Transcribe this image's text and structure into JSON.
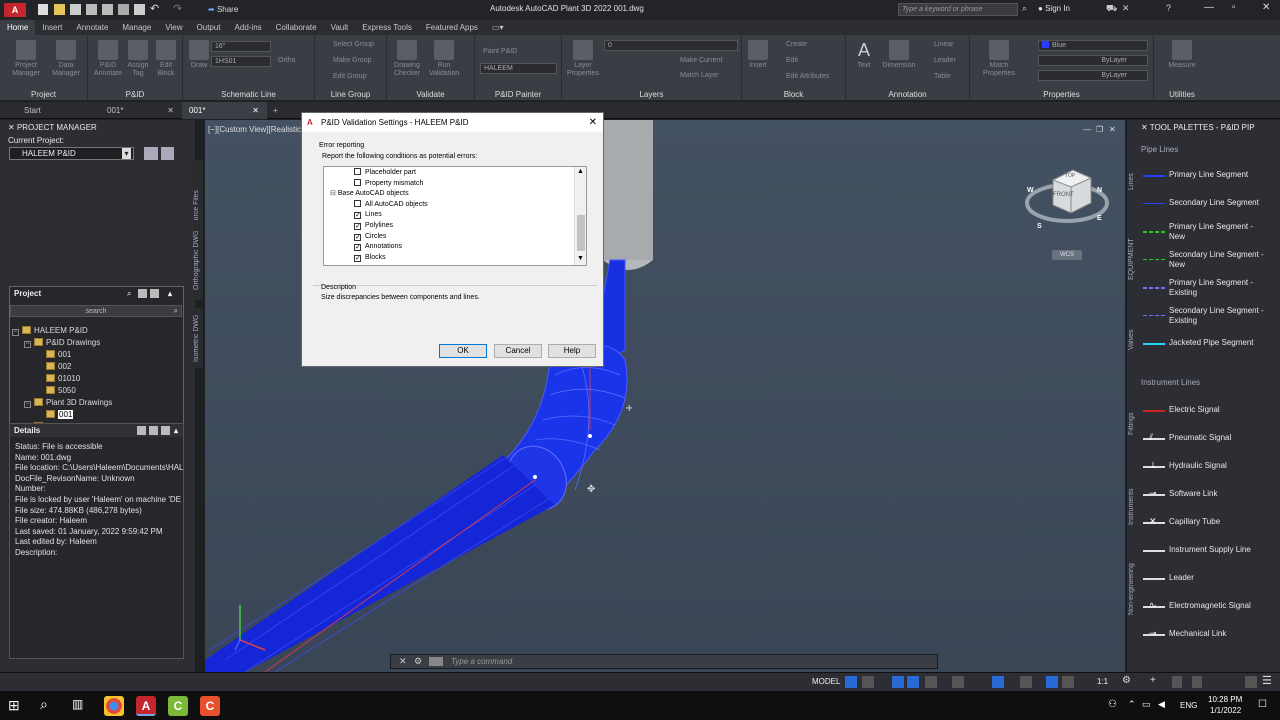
{
  "app": {
    "title": "Autodesk AutoCAD Plant 3D 2022   001.dwg",
    "share_label": "Share",
    "search_placeholder": "Type a keyword or phrase",
    "sign_in_label": "Sign In"
  },
  "ribbon_tabs": [
    "Home",
    "Insert",
    "Annotate",
    "Manage",
    "View",
    "Output",
    "Add-ins",
    "Collaborate",
    "Vault",
    "Express Tools",
    "Featured Apps"
  ],
  "ribbon_panels": {
    "project": {
      "title": "Project",
      "btn1": "Project Manager",
      "btn2": "Data Manager"
    },
    "pid": {
      "title": "P&ID",
      "btn1": "P&ID Annotate",
      "btn2": "Assign Tag",
      "btn3": "Edit Block"
    },
    "schematic": {
      "title": "Schematic Line",
      "size": "16\"",
      "spec": "1HS01",
      "draw": "Draw",
      "ortho": "Ortho"
    },
    "linegroup": {
      "title": "Line Group",
      "select": "Select Group",
      "edit": "Edit",
      "make": "Make Group",
      "edit_group": "Edit Group"
    },
    "validate": {
      "title": "Validate",
      "btn1": "Drawing Checker",
      "btn2": "Run Validation"
    },
    "painter": {
      "title": "P&ID Painter",
      "paint": "Paint P&ID",
      "value": "HALEEM"
    },
    "layers": {
      "title": "Layers",
      "layer_props": "Layer Properties",
      "layer_value": "0",
      "make_current": "Make Current",
      "match_layer": "Match Layer"
    },
    "block": {
      "title": "Block",
      "insert": "Insert",
      "create": "Create",
      "edit": "Edit",
      "edit_attr": "Edit Attributes"
    },
    "annotation": {
      "title": "Annotation",
      "text": "Text",
      "dimension": "Dimension",
      "linear": "Linear",
      "leader": "Leader",
      "table": "Table"
    },
    "properties": {
      "title": "Properties",
      "match": "Match Properties",
      "color": "Blue",
      "bylayer1": "ByLayer",
      "bylayer2": "ByLayer"
    },
    "utilities": {
      "title": "Utilities",
      "measure": "Measure"
    }
  },
  "doc_tabs": [
    {
      "label": "Start"
    },
    {
      "label": "001*"
    },
    {
      "label": "001*"
    }
  ],
  "viewport_label": "[−][Custom View][Realistic]",
  "project_manager": {
    "title": "PROJECT MANAGER",
    "current_project_label": "Current Project:",
    "current_project": "HALEEM P&ID",
    "project_header": "Project",
    "search_placeholder": "search",
    "tree": [
      {
        "label": "HALEEM P&ID",
        "level": 0,
        "exp": "−"
      },
      {
        "label": "P&ID Drawings",
        "level": 1,
        "exp": "−"
      },
      {
        "label": "001",
        "level": 2,
        "exp": ""
      },
      {
        "label": "002",
        "level": 2,
        "exp": ""
      },
      {
        "label": "01010",
        "level": 2,
        "exp": ""
      },
      {
        "label": "5050",
        "level": 2,
        "exp": ""
      },
      {
        "label": "Plant 3D Drawings",
        "level": 1,
        "exp": "−"
      },
      {
        "label": "001",
        "level": 2,
        "exp": "",
        "selected": true
      },
      {
        "label": "Pipe Specs",
        "level": 1,
        "exp": "+"
      },
      {
        "label": "Related Files",
        "level": 1,
        "exp": "+"
      }
    ],
    "side_tabs": [
      "Source Files",
      "Orthographic DWG",
      "Isometric DWG"
    ]
  },
  "details": {
    "title": "Details",
    "lines": [
      "Status: File is accessible",
      "Name: 001.dwg",
      "File location: C:\\Users\\Haleem\\Documents\\HAL",
      "DocFile_RevisonName:  Unknown",
      "Number:",
      "File is locked by user 'Haleem' on machine 'DE",
      "File size: 474.88KB (486,278 bytes)",
      "File creator: Haleem",
      "Last saved: 01 January, 2022 9:59:42 PM",
      "Last edited by: Haleem",
      "Description:"
    ]
  },
  "dialog": {
    "title": "P&ID Validation Settings - HALEEM P&ID",
    "group_label": "Error reporting",
    "instruction": "Report the following conditions as potential errors:",
    "items": [
      {
        "label": "Placeholder part",
        "checked": false,
        "indent": 2
      },
      {
        "label": "Property mismatch",
        "checked": false,
        "indent": 2
      },
      {
        "label": "Base AutoCAD objects",
        "checked": null,
        "indent": 0,
        "exp": "−"
      },
      {
        "label": "All AutoCAD objects",
        "checked": false,
        "indent": 2
      },
      {
        "label": "Lines",
        "checked": true,
        "indent": 2
      },
      {
        "label": "Polylines",
        "checked": true,
        "indent": 2
      },
      {
        "label": "Circles",
        "checked": true,
        "indent": 2
      },
      {
        "label": "Annotations",
        "checked": true,
        "indent": 2
      },
      {
        "label": "Blocks",
        "checked": true,
        "indent": 2
      }
    ],
    "description_label": "Description",
    "description_text": "Size discrepancies between components and lines.",
    "ok_label": "OK",
    "cancel_label": "Cancel",
    "help_label": "Help"
  },
  "viewcube": {
    "top": "TOP",
    "front": "FRONT",
    "compass": [
      "N",
      "E",
      "S",
      "W"
    ],
    "wcs": "WCS"
  },
  "tool_palette": {
    "title": "TOOL PALETTES - P&ID PIP",
    "pipe_lines_group": "Pipe Lines",
    "pipe_lines": [
      {
        "label": "Primary Line Segment",
        "color": "#2a3cff",
        "style": "solid",
        "width": 2
      },
      {
        "label": "Secondary Line Segment",
        "color": "#2a3cff",
        "style": "solid",
        "width": 1
      },
      {
        "label": "Primary Line Segment - New",
        "color": "#22cc22",
        "style": "dashed",
        "width": 2
      },
      {
        "label": "Secondary Line Segment - New",
        "color": "#22cc22",
        "style": "dashed",
        "width": 1
      },
      {
        "label": "Primary Line Segment - Existing",
        "color": "#7a6cff",
        "style": "dashed",
        "width": 2
      },
      {
        "label": "Secondary Line Segment - Existing",
        "color": "#7a6cff",
        "style": "dashed",
        "width": 1
      },
      {
        "label": "Jacketed Pipe Segment",
        "color": "#22d8ff",
        "style": "solid",
        "width": 2
      }
    ],
    "instrument_lines_group": "Instrument Lines",
    "instrument_lines": [
      {
        "label": "Electric Signal",
        "color": "#cc2222"
      },
      {
        "label": "Pneumatic Signal",
        "color": "#dddddd"
      },
      {
        "label": "Hydraulic Signal",
        "color": "#dddddd"
      },
      {
        "label": "Software Link",
        "color": "#dddddd"
      },
      {
        "label": "Capillary Tube",
        "color": "#dddddd"
      },
      {
        "label": "Instrument Supply Line",
        "color": "#dddddd"
      },
      {
        "label": "Leader",
        "color": "#dddddd"
      },
      {
        "label": "Electromagnetic Signal",
        "color": "#dddddd"
      },
      {
        "label": "Mechanical Link",
        "color": "#dddddd"
      }
    ],
    "side_tabs": [
      "Lines",
      "EQUIPMENT",
      "Valves",
      "Fittings",
      "Instruments",
      "Non-engineering"
    ]
  },
  "command_line": {
    "placeholder": "Type a command"
  },
  "status_bar": {
    "model": "MODEL",
    "scale": "1:1"
  },
  "taskbar": {
    "language": "ENG",
    "time": "10:28 PM",
    "date": "1/1/2022"
  },
  "colors": {
    "pipe": "#1526d6",
    "pipe_light": "#3a4cff",
    "viewport": "#3e4a5a",
    "accent": "#2a6ad6"
  }
}
